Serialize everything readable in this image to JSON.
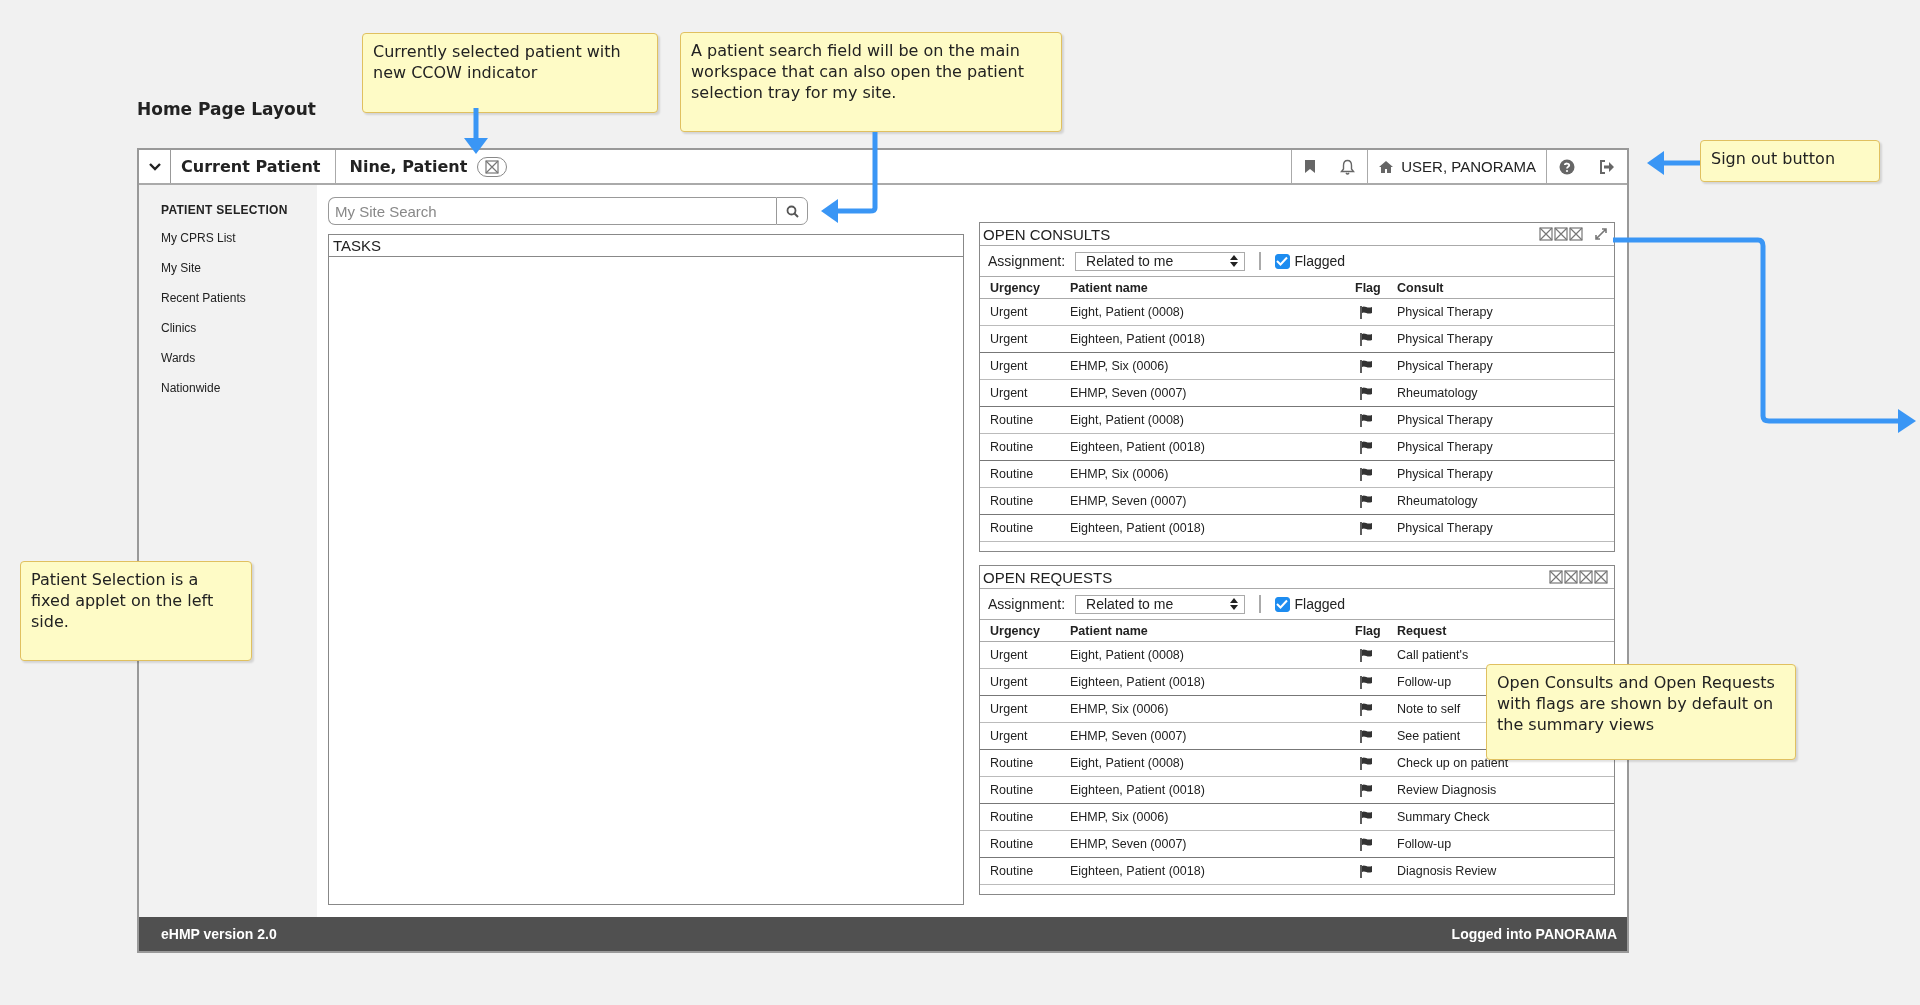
{
  "page_title": "Home Page Layout",
  "header": {
    "breadcrumb": "Current Patient",
    "patient": "Nine, Patient",
    "user": "USER, PANORAMA"
  },
  "sidebar": {
    "heading": "PATIENT SELECTION",
    "items": [
      "My CPRS List",
      "My Site",
      "Recent Patients",
      "Clinics",
      "Wards",
      "Nationwide"
    ]
  },
  "search": {
    "placeholder": "My Site Search"
  },
  "tasks": {
    "title": "TASKS"
  },
  "applets": [
    {
      "title": "OPEN CONSULTS",
      "expandable": true,
      "assignment_label": "Assignment:",
      "assignment": "Related to me",
      "flagged_label": "Flagged",
      "flagged": true,
      "columns": [
        "Urgency",
        "Patient name",
        "Flag",
        "Consult"
      ],
      "rows": [
        {
          "urgency": "Urgent",
          "patient": "Eight, Patient (0008)",
          "flagged": true,
          "detail": "Physical Therapy"
        },
        {
          "urgency": "Urgent",
          "patient": "Eighteen, Patient (0018)",
          "flagged": true,
          "detail": "Physical Therapy"
        },
        {
          "urgency": "Urgent",
          "patient": "EHMP, Six (0006)",
          "flagged": true,
          "detail": "Physical Therapy"
        },
        {
          "urgency": "Urgent",
          "patient": "EHMP, Seven (0007)",
          "flagged": true,
          "detail": "Rheumatology"
        },
        {
          "urgency": "Routine",
          "patient": "Eight, Patient (0008)",
          "flagged": true,
          "detail": "Physical Therapy"
        },
        {
          "urgency": "Routine",
          "patient": "Eighteen, Patient (0018)",
          "flagged": true,
          "detail": "Physical Therapy"
        },
        {
          "urgency": "Routine",
          "patient": "EHMP, Six (0006)",
          "flagged": true,
          "detail": "Physical Therapy"
        },
        {
          "urgency": "Routine",
          "patient": "EHMP, Seven (0007)",
          "flagged": true,
          "detail": "Rheumatology"
        },
        {
          "urgency": "Routine",
          "patient": "Eighteen, Patient (0018)",
          "flagged": true,
          "detail": "Physical Therapy"
        }
      ]
    },
    {
      "title": "OPEN REQUESTS",
      "expandable": false,
      "assignment_label": "Assignment:",
      "assignment": "Related to me",
      "flagged_label": "Flagged",
      "flagged": true,
      "columns": [
        "Urgency",
        "Patient name",
        "Flag",
        "Request"
      ],
      "rows": [
        {
          "urgency": "Urgent",
          "patient": "Eight, Patient (0008)",
          "flagged": true,
          "detail": "Call patient's"
        },
        {
          "urgency": "Urgent",
          "patient": "Eighteen, Patient (0018)",
          "flagged": true,
          "detail": "Follow-up"
        },
        {
          "urgency": "Urgent",
          "patient": "EHMP, Six (0006)",
          "flagged": true,
          "detail": "Note to self"
        },
        {
          "urgency": "Urgent",
          "patient": "EHMP, Seven (0007)",
          "flagged": true,
          "detail": "See patient"
        },
        {
          "urgency": "Routine",
          "patient": "Eight, Patient (0008)",
          "flagged": true,
          "detail": "Check up on patient"
        },
        {
          "urgency": "Routine",
          "patient": "Eighteen, Patient (0018)",
          "flagged": true,
          "detail": "Review Diagnosis"
        },
        {
          "urgency": "Routine",
          "patient": "EHMP, Six (0006)",
          "flagged": true,
          "detail": "Summary Check"
        },
        {
          "urgency": "Routine",
          "patient": "EHMP, Seven (0007)",
          "flagged": true,
          "detail": "Follow-up"
        },
        {
          "urgency": "Routine",
          "patient": "Eighteen, Patient (0018)",
          "flagged": true,
          "detail": "Diagnosis Review"
        }
      ]
    }
  ],
  "footer": {
    "version": "eHMP version 2.0",
    "login": "Logged into PANORAMA"
  },
  "notes": [
    {
      "text": "Currently selected patient with new CCOW indicator"
    },
    {
      "text": "A patient search field will be on the main workspace that can also open the patient selection tray for my site."
    },
    {
      "text": "Sign out button"
    },
    {
      "text": "Patient Selection is a fixed applet on the left side."
    },
    {
      "text": "Open Consults and Open Requests with flags are shown by default on the summary views"
    }
  ]
}
